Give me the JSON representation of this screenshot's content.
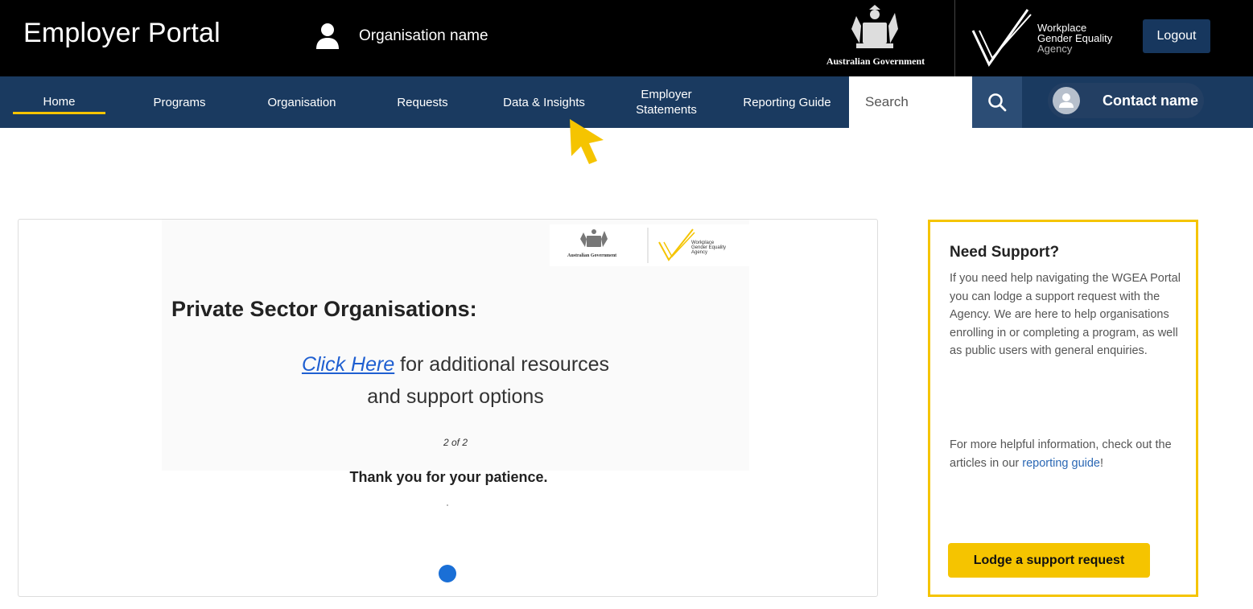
{
  "header": {
    "app_title": "Employer Portal",
    "org_name": "Organisation name",
    "gov_logo_text": "Australian Government",
    "wgea_logo_lines": [
      "Workplace",
      "Gender Equality",
      "Agency"
    ],
    "logout_label": "Logout"
  },
  "nav": {
    "items": [
      {
        "label": "Home",
        "active": true
      },
      {
        "label": "Programs"
      },
      {
        "label": "Organisation"
      },
      {
        "label": "Requests"
      },
      {
        "label": "Data & Insights"
      },
      {
        "label": "Employer Statements"
      },
      {
        "label": "Reporting Guide"
      }
    ],
    "search_placeholder": "Search",
    "contact_name": "Contact name"
  },
  "carousel": {
    "slide_gov_text": "Australian Government",
    "slide_wgea_lines": [
      "Workplace",
      "Gender Equality",
      "Agency"
    ],
    "heading": "Private Sector Organisations:",
    "link_text": "Click Here",
    "body_line1_rest": " for additional resources",
    "body_line2": "and support options",
    "pager": "2 of 2",
    "patience_text": "Thank you for your patience."
  },
  "support": {
    "title": "Need Support?",
    "body": "If you need help navigating the WGEA Portal you can lodge a support request with the Agency. We are here to help organisations enrolling in or completing a program, as well as public users with general enquiries.",
    "body2_prefix": "For more helpful information, check out the articles in our ",
    "body2_link": "reporting guide",
    "body2_suffix": "!",
    "button_label": "Lodge a support request"
  },
  "colors": {
    "topbar": "#000000",
    "navbar": "#1a3a60",
    "accent_yellow": "#f5c400",
    "link_blue": "#1f5fd1",
    "indicator_blue": "#1a6fd6"
  }
}
